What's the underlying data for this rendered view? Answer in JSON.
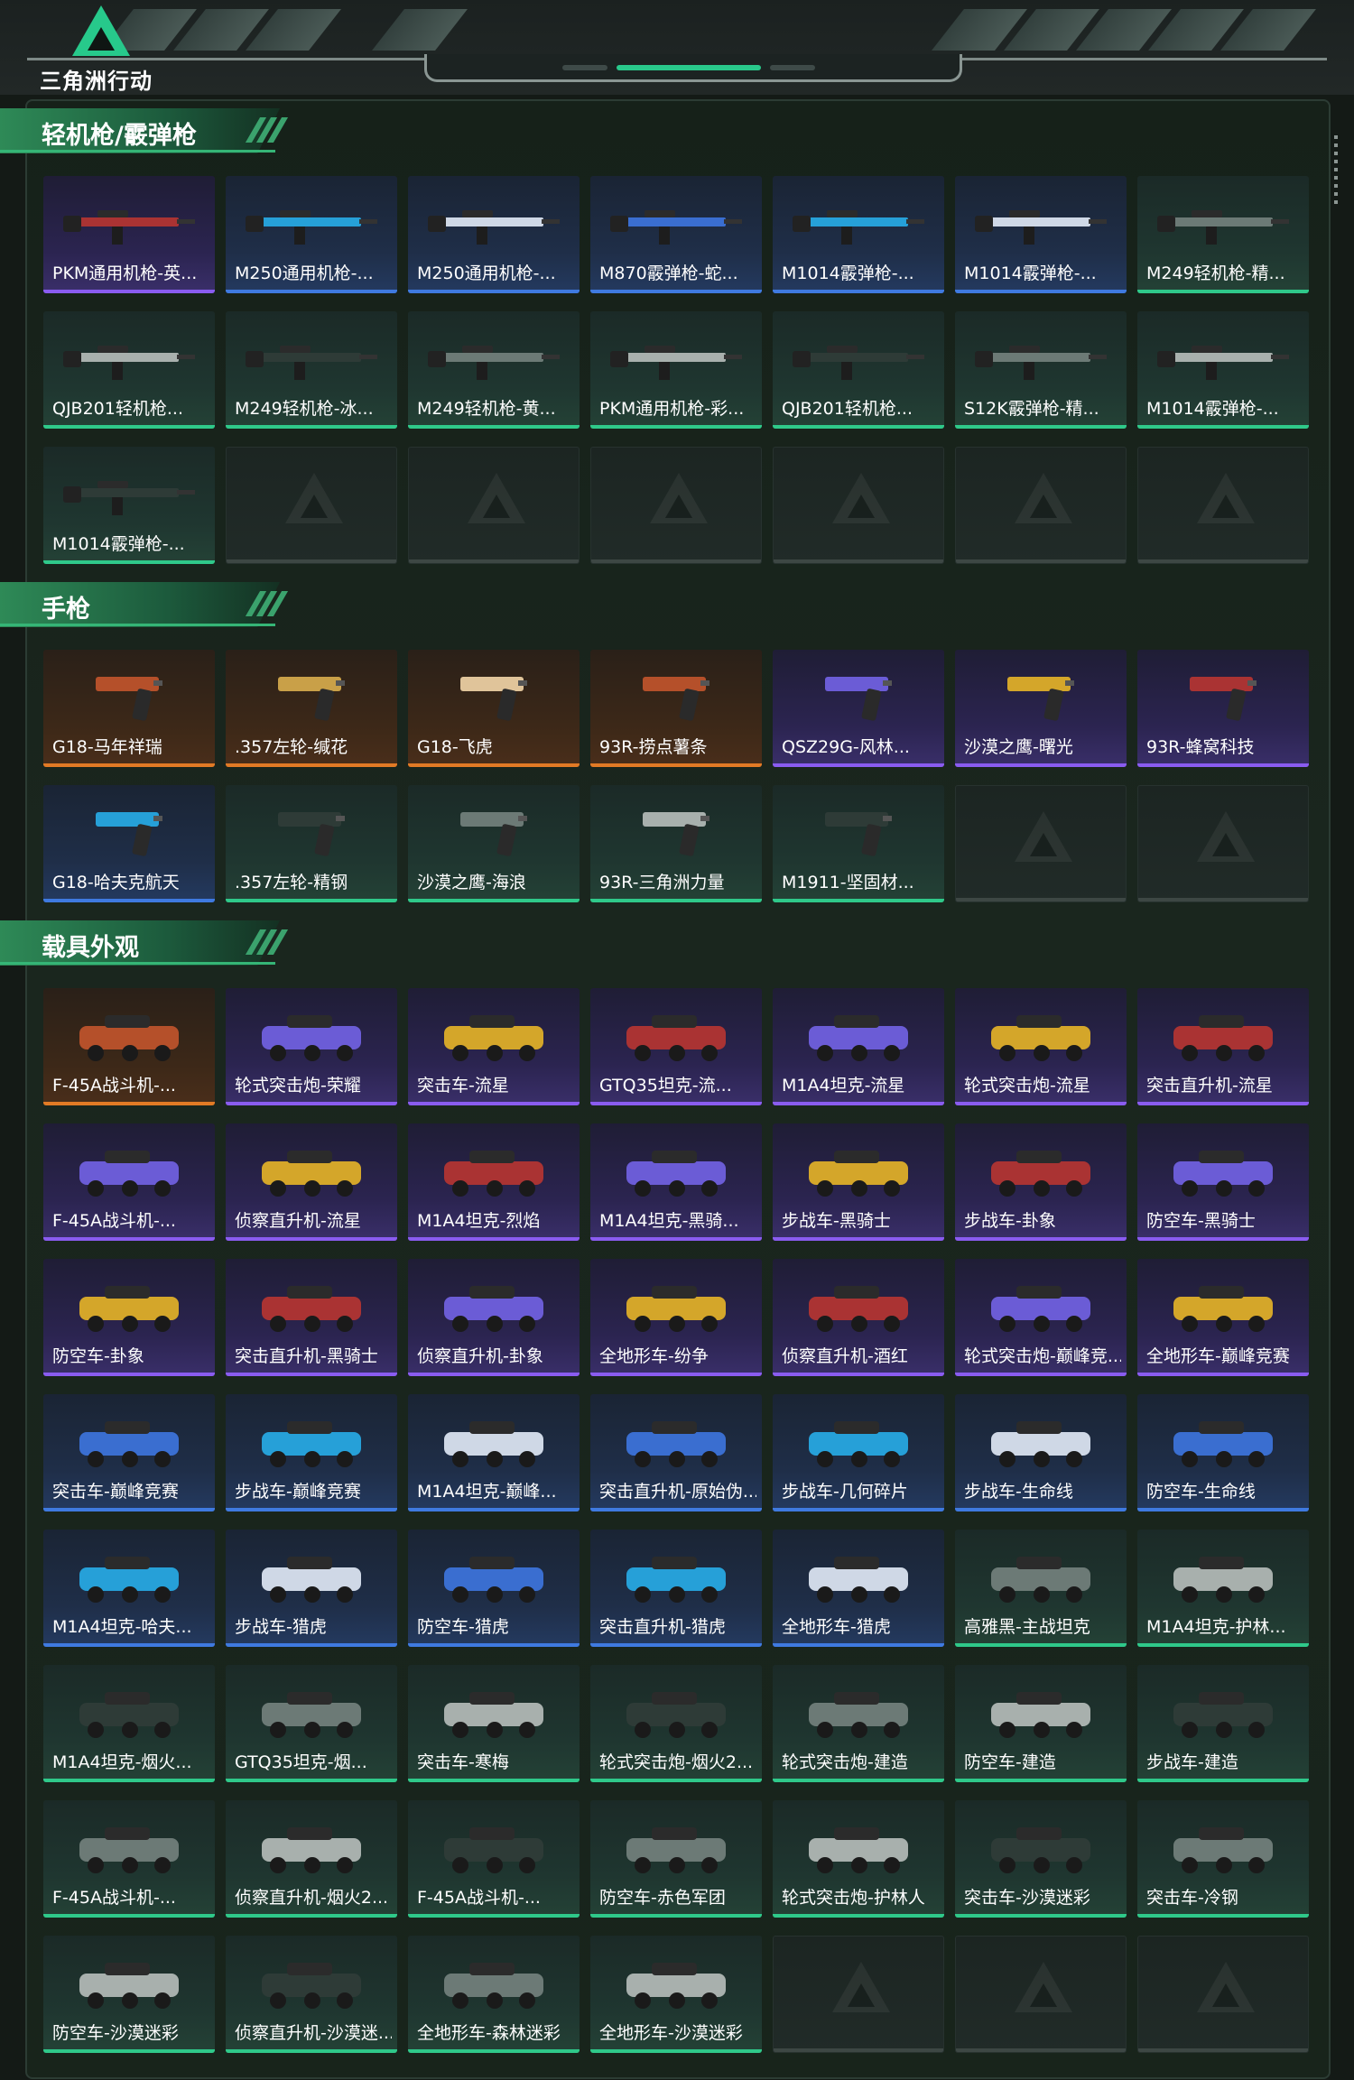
{
  "header": {
    "logo_text": "三角洲行动"
  },
  "colors": {
    "purple": "#8a5cf0",
    "blue": "#3f7ae0",
    "green": "#2fc98a",
    "orange": "#e27a25",
    "accent": "#27c98b"
  },
  "sections": [
    {
      "title": "轻机枪/霰弹枪",
      "kind": "rifle",
      "items": [
        {
          "label": "PKM通用机枪-英...",
          "rarity": "purple"
        },
        {
          "label": "M250通用机枪-...",
          "rarity": "blue"
        },
        {
          "label": "M250通用机枪-...",
          "rarity": "blue"
        },
        {
          "label": "M870霰弹枪-蛇...",
          "rarity": "blue"
        },
        {
          "label": "M1014霰弹枪-...",
          "rarity": "blue"
        },
        {
          "label": "M1014霰弹枪-...",
          "rarity": "blue"
        },
        {
          "label": "M249轻机枪-精...",
          "rarity": "green"
        },
        {
          "label": "QJB201轻机枪...",
          "rarity": "green"
        },
        {
          "label": "M249轻机枪-冰...",
          "rarity": "green"
        },
        {
          "label": "M249轻机枪-黄...",
          "rarity": "green"
        },
        {
          "label": "PKM通用机枪-彩...",
          "rarity": "green"
        },
        {
          "label": "QJB201轻机枪...",
          "rarity": "green"
        },
        {
          "label": "S12K霰弹枪-精...",
          "rarity": "green"
        },
        {
          "label": "M1014霰弹枪-...",
          "rarity": "green"
        },
        {
          "label": "M1014霰弹枪-...",
          "rarity": "green"
        },
        {
          "label": "",
          "rarity": "empty"
        },
        {
          "label": "",
          "rarity": "empty"
        },
        {
          "label": "",
          "rarity": "empty"
        },
        {
          "label": "",
          "rarity": "empty"
        },
        {
          "label": "",
          "rarity": "empty"
        },
        {
          "label": "",
          "rarity": "empty"
        }
      ]
    },
    {
      "title": "手枪",
      "kind": "pistol",
      "items": [
        {
          "label": "G18-马年祥瑞",
          "rarity": "orange"
        },
        {
          "label": ".357左轮-缄花",
          "rarity": "orange"
        },
        {
          "label": "G18-飞虎",
          "rarity": "orange"
        },
        {
          "label": "93R-捞点薯条",
          "rarity": "orange"
        },
        {
          "label": "QSZ29G-风林...",
          "rarity": "purple"
        },
        {
          "label": "沙漠之鹰-曙光",
          "rarity": "purple"
        },
        {
          "label": "93R-蜂窝科技",
          "rarity": "purple"
        },
        {
          "label": "G18-哈夫克航天",
          "rarity": "blue"
        },
        {
          "label": ".357左轮-精钢",
          "rarity": "green"
        },
        {
          "label": "沙漠之鹰-海浪",
          "rarity": "green"
        },
        {
          "label": "93R-三角洲力量",
          "rarity": "green"
        },
        {
          "label": "M1911-坚固材...",
          "rarity": "green"
        },
        {
          "label": "",
          "rarity": "empty"
        },
        {
          "label": "",
          "rarity": "empty"
        }
      ]
    },
    {
      "title": "载具外观",
      "kind": "vehicle",
      "items": [
        {
          "label": "F-45A战斗机-...",
          "rarity": "orange"
        },
        {
          "label": "轮式突击炮-荣耀",
          "rarity": "purple"
        },
        {
          "label": "突击车-流星",
          "rarity": "purple"
        },
        {
          "label": "GTQ35坦克-流...",
          "rarity": "purple"
        },
        {
          "label": "M1A4坦克-流星",
          "rarity": "purple"
        },
        {
          "label": "轮式突击炮-流星",
          "rarity": "purple"
        },
        {
          "label": "突击直升机-流星",
          "rarity": "purple"
        },
        {
          "label": "F-45A战斗机-...",
          "rarity": "purple"
        },
        {
          "label": "侦察直升机-流星",
          "rarity": "purple"
        },
        {
          "label": "M1A4坦克-烈焰",
          "rarity": "purple"
        },
        {
          "label": "M1A4坦克-黑骑...",
          "rarity": "purple"
        },
        {
          "label": "步战车-黑骑士",
          "rarity": "purple"
        },
        {
          "label": "步战车-卦象",
          "rarity": "purple"
        },
        {
          "label": "防空车-黑骑士",
          "rarity": "purple"
        },
        {
          "label": "防空车-卦象",
          "rarity": "purple"
        },
        {
          "label": "突击直升机-黑骑士",
          "rarity": "purple"
        },
        {
          "label": "侦察直升机-卦象",
          "rarity": "purple"
        },
        {
          "label": "全地形车-纷争",
          "rarity": "purple"
        },
        {
          "label": "侦察直升机-酒红",
          "rarity": "purple"
        },
        {
          "label": "轮式突击炮-巅峰竞...",
          "rarity": "purple"
        },
        {
          "label": "全地形车-巅峰竞赛",
          "rarity": "purple"
        },
        {
          "label": "突击车-巅峰竞赛",
          "rarity": "blue"
        },
        {
          "label": "步战车-巅峰竞赛",
          "rarity": "blue"
        },
        {
          "label": "M1A4坦克-巅峰...",
          "rarity": "blue"
        },
        {
          "label": "突击直升机-原始伪...",
          "rarity": "blue"
        },
        {
          "label": "步战车-几何碎片",
          "rarity": "blue"
        },
        {
          "label": "步战车-生命线",
          "rarity": "blue"
        },
        {
          "label": "防空车-生命线",
          "rarity": "blue"
        },
        {
          "label": "M1A4坦克-哈夫...",
          "rarity": "blue"
        },
        {
          "label": "步战车-猎虎",
          "rarity": "blue"
        },
        {
          "label": "防空车-猎虎",
          "rarity": "blue"
        },
        {
          "label": "突击直升机-猎虎",
          "rarity": "blue"
        },
        {
          "label": "全地形车-猎虎",
          "rarity": "blue"
        },
        {
          "label": "高雅黑-主战坦克",
          "rarity": "green"
        },
        {
          "label": "M1A4坦克-护林...",
          "rarity": "green"
        },
        {
          "label": "M1A4坦克-烟火...",
          "rarity": "green"
        },
        {
          "label": "GTQ35坦克-烟...",
          "rarity": "green"
        },
        {
          "label": "突击车-寒梅",
          "rarity": "green"
        },
        {
          "label": "轮式突击炮-烟火2...",
          "rarity": "green"
        },
        {
          "label": "轮式突击炮-建造",
          "rarity": "green"
        },
        {
          "label": "防空车-建造",
          "rarity": "green"
        },
        {
          "label": "步战车-建造",
          "rarity": "green"
        },
        {
          "label": "F-45A战斗机-...",
          "rarity": "green"
        },
        {
          "label": "侦察直升机-烟火2...",
          "rarity": "green"
        },
        {
          "label": "F-45A战斗机-...",
          "rarity": "green"
        },
        {
          "label": "防空车-赤色军团",
          "rarity": "green"
        },
        {
          "label": "轮式突击炮-护林人",
          "rarity": "green"
        },
        {
          "label": "突击车-沙漠迷彩",
          "rarity": "green"
        },
        {
          "label": "突击车-冷钢",
          "rarity": "green"
        },
        {
          "label": "防空车-沙漠迷彩",
          "rarity": "green"
        },
        {
          "label": "侦察直升机-沙漠迷...",
          "rarity": "green"
        },
        {
          "label": "全地形车-森林迷彩",
          "rarity": "green"
        },
        {
          "label": "全地形车-沙漠迷彩",
          "rarity": "green"
        },
        {
          "label": "",
          "rarity": "empty"
        },
        {
          "label": "",
          "rarity": "empty"
        },
        {
          "label": "",
          "rarity": "empty"
        }
      ]
    }
  ]
}
